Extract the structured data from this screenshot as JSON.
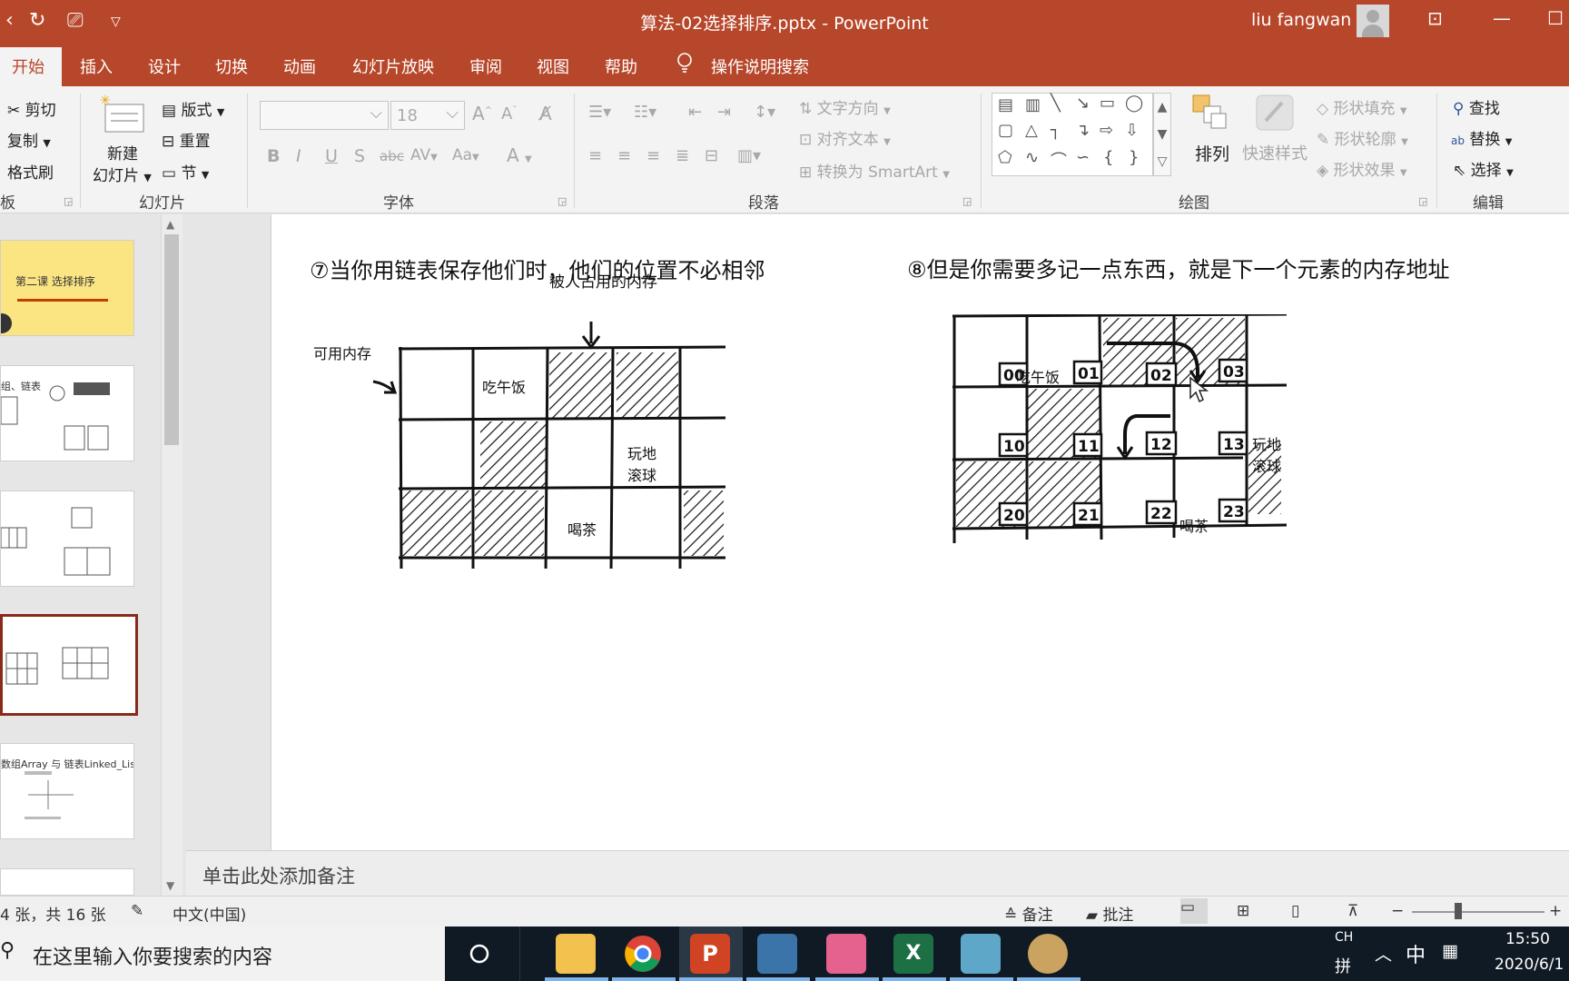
{
  "window": {
    "title": "算法-02选择排序.pptx  -  PowerPoint",
    "user": "liu fangwan"
  },
  "tabs": [
    "开始",
    "插入",
    "设计",
    "切换",
    "动画",
    "幻灯片放映",
    "审阅",
    "视图",
    "帮助"
  ],
  "tell_me": "操作说明搜索",
  "ribbon": {
    "clipboard": {
      "cut": "剪切",
      "copy": "复制",
      "format_painter": "格式刷",
      "label": "板"
    },
    "slides": {
      "new_slide_1": "新建",
      "new_slide_2": "幻灯片",
      "layout": "版式",
      "reset": "重置",
      "section": "节",
      "label": "幻灯片"
    },
    "font": {
      "size": "18",
      "label": "字体"
    },
    "paragraph": {
      "text_direction": "文字方向",
      "align_text": "对齐文本",
      "smartart": "转换为 SmartArt",
      "label": "段落"
    },
    "drawing": {
      "arrange": "排列",
      "quick_styles": "快速样式",
      "fill": "形状填充",
      "outline": "形状轮廓",
      "effects": "形状效果",
      "label": "绘图"
    },
    "editing": {
      "find": "查找",
      "replace": "替换",
      "select": "选择",
      "label": "编辑"
    }
  },
  "thumbnails": {
    "slide1_title": "第二课 选择排序",
    "slide2_text": "组、链表",
    "slide5_title": "数组Array 与 链表Linked_List"
  },
  "slide": {
    "caption_left": "⑦当你用链表保存他们时，他们的位置不必相邻",
    "caption_right": "⑧但是你需要多记一点东西，就是下一个元素的内存地址",
    "left_grid": {
      "label_occupied": "被人占用的内存",
      "label_available": "可用内存",
      "lunch": "吃午饭",
      "bowling_1": "玩地",
      "bowling_2": "滚球",
      "tea": "喝茶"
    },
    "right_grid": {
      "cells": [
        "00",
        "01",
        "02",
        "03",
        "10",
        "11",
        "12",
        "13",
        "20",
        "21",
        "22",
        "23"
      ],
      "lunch": "吃午饭",
      "bowling_1": "玩地",
      "bowling_2": "滚球",
      "tea": "喝茶"
    }
  },
  "notes_placeholder": "单击此处添加备注",
  "status": {
    "slide_info": "4 张，共 16 张",
    "language": "中文(中国)",
    "notes": "备注",
    "comments": "批注"
  },
  "taskbar": {
    "search_placeholder": "在这里输入你要搜索的内容",
    "ime_ch": "CH",
    "ime_pin": "拼",
    "ime_mode": "中",
    "time": "15:50",
    "date": "2020/6/1"
  },
  "colors": {
    "accent": "#b7472a",
    "taskbar": "#101a24"
  }
}
